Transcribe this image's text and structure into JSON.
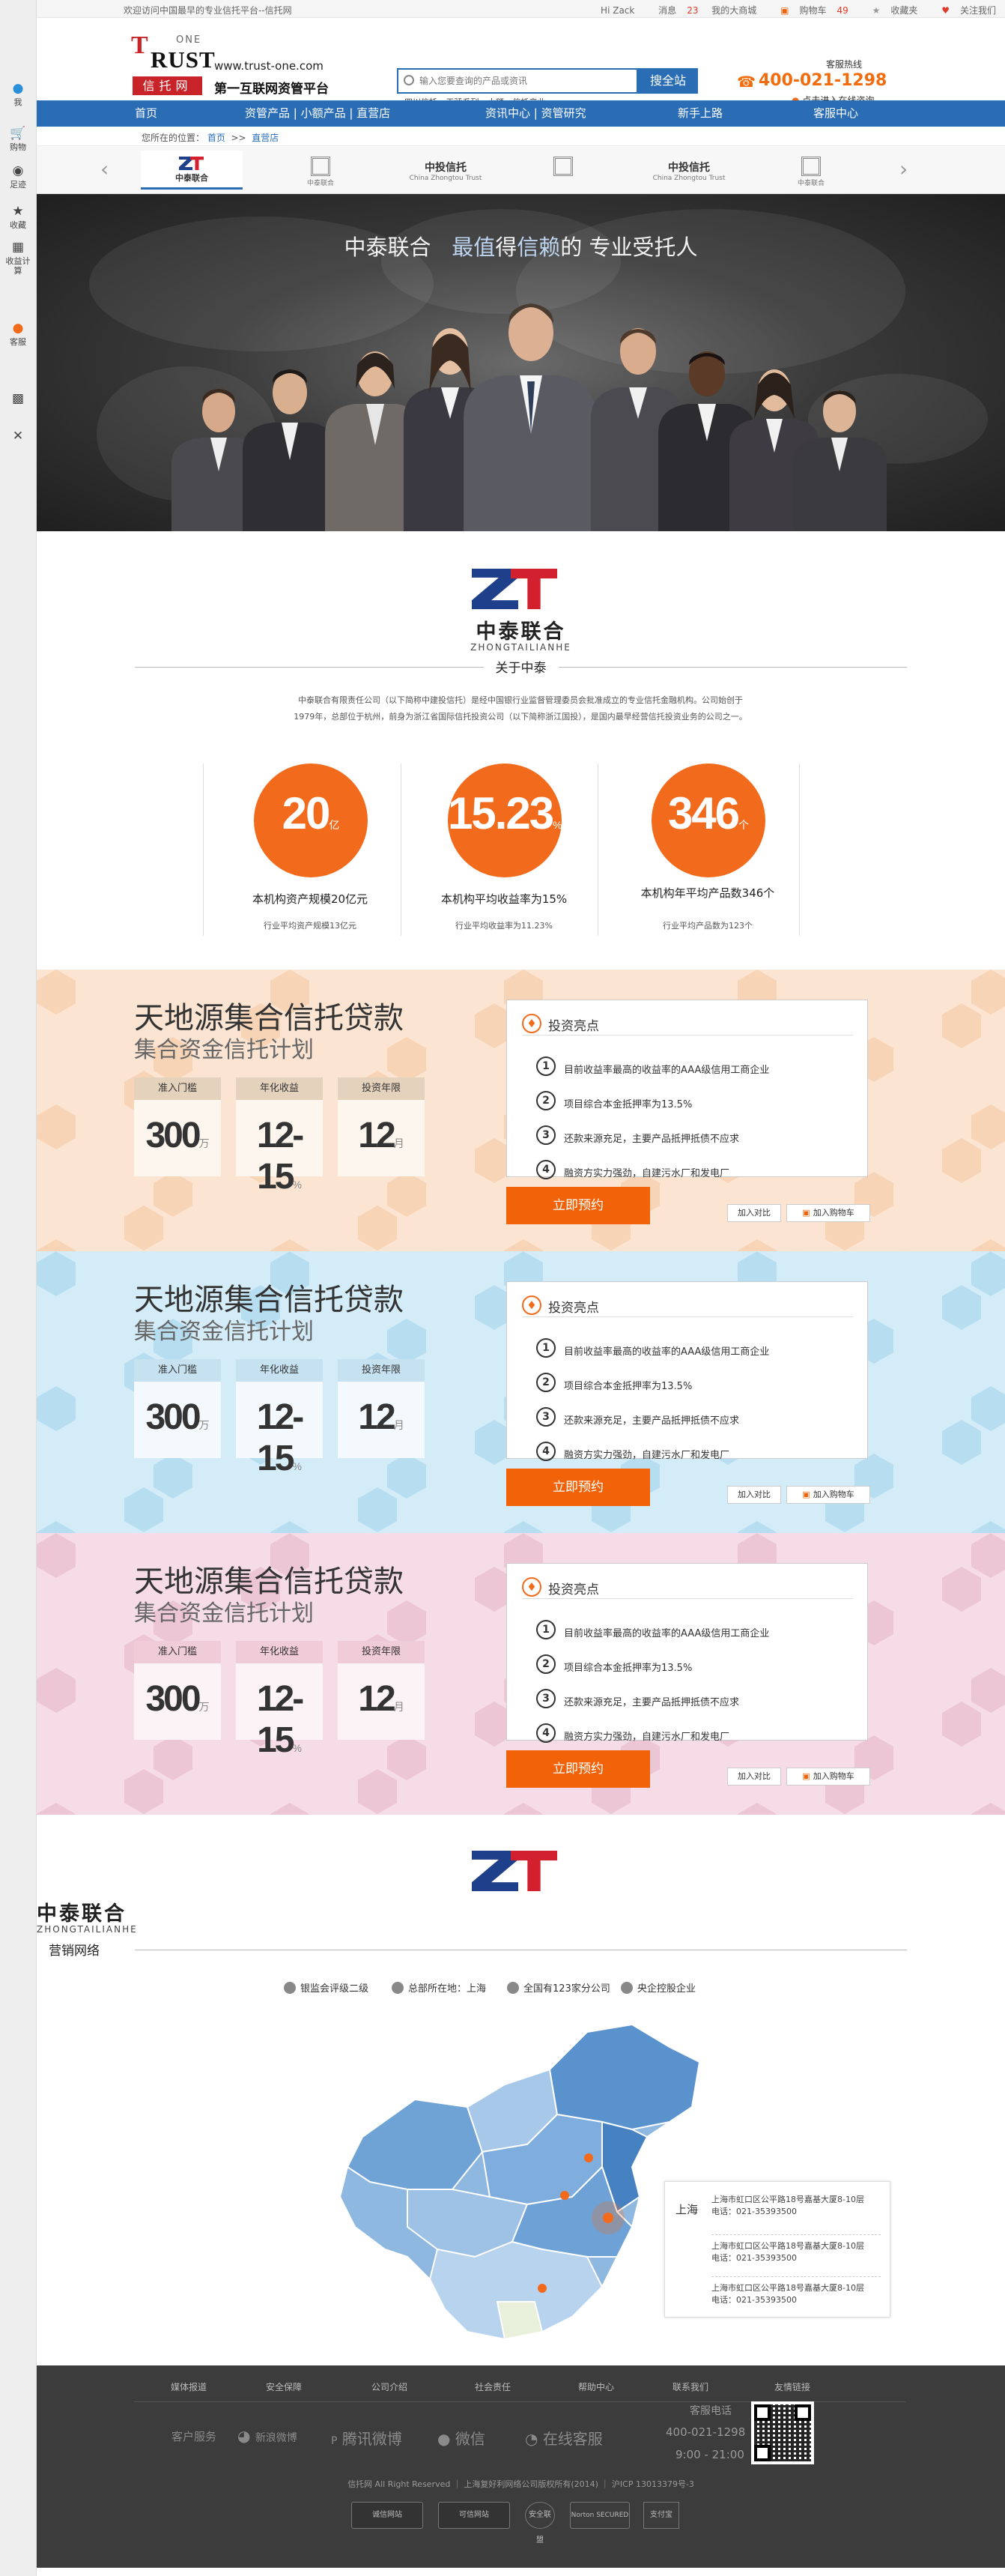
{
  "sidebar": {
    "items": [
      {
        "icon": "user-icon",
        "label": "我"
      },
      {
        "icon": "cart-icon",
        "label": "购物"
      },
      {
        "icon": "eye-icon",
        "label": "足迹"
      },
      {
        "icon": "star-icon",
        "label": "收藏"
      },
      {
        "icon": "calculator-icon",
        "label": "收益计算"
      },
      {
        "icon": "chat-icon",
        "label": "客服"
      },
      {
        "icon": "qrcode-icon",
        "label": ""
      },
      {
        "icon": "close-icon",
        "label": ""
      }
    ]
  },
  "topbar": {
    "welcome": "欢迎访问中国最早的专业信托平台--信托网",
    "greeting": "Hi Zack",
    "messages": "消息",
    "messages_count": "23",
    "my_mall": "我的大商城",
    "cart": "购物车",
    "cart_count": "49",
    "favorites": "收藏夹",
    "follow": "关注我们"
  },
  "header": {
    "logo_trust": "RUST",
    "logo_t": "T",
    "logo_one": "ONE",
    "logo_cn": "信托网",
    "site_url": "www.trust-one.com",
    "slogan": "第一互联网资管平台",
    "search_placeholder": "输入您要查询的产品或资讯",
    "search_button": "搜全站",
    "hot_words": [
      "四川信托",
      "天骄系列",
      "小额",
      "信托产业"
    ],
    "hotline_label": "客服热线",
    "hotline_number": "400-021-1298",
    "online_consult": "点击进入在线咨询"
  },
  "nav": {
    "items": [
      "首页",
      "资管产品 | 小额产品 | 直营店",
      "资讯中心 | 资管研究",
      "新手上路",
      "客服中心"
    ]
  },
  "breadcrumb": {
    "prefix": "您所在的位置",
    "home": "首页",
    "sep": ">>",
    "current": "直营店"
  },
  "brands": {
    "items": [
      {
        "type": "zt",
        "label": "中泰联合"
      },
      {
        "type": "box",
        "label": "中泰联合"
      },
      {
        "type": "text",
        "label": "中投信托",
        "sub": "China Zhongtou Trust"
      },
      {
        "type": "box",
        "label": ""
      },
      {
        "type": "text",
        "label": "中投信托",
        "sub": "China Zhongtou Trust"
      },
      {
        "type": "box",
        "label": "中泰联合"
      }
    ],
    "prev": "‹",
    "next": "›"
  },
  "hero": {
    "title_part1": "中泰联合",
    "title_highlight1": "最值",
    "title_part2": "得",
    "title_highlight2": "信赖",
    "title_part3": "的 专业受托人"
  },
  "about": {
    "company_cn": "中泰联合",
    "company_en": "ZHONGTAILIANHE",
    "section_title": "关于中泰",
    "intro": "中泰联合有限责任公司（以下简称中建投信托）是经中国银行业监督管理委员会批准成立的专业信托金融机构。公司始创于1979年，总部位于杭州，前身为浙江省国际信托投资公司（以下简称浙江国投），是国内最早经营信托投资业务的公司之一。",
    "stats": [
      {
        "value": "20",
        "unit": "亿",
        "label": "本机构资产规模20亿元",
        "sub": "行业平均资产规模13亿元"
      },
      {
        "value": "15.23",
        "unit": "%",
        "label": "本机构平均收益率为15%",
        "sub": "行业平均收益率为11.23%"
      },
      {
        "value": "346",
        "unit": "个",
        "label": "本机构年平均产品数346个",
        "sub": "行业平均产品数为123个"
      }
    ]
  },
  "products": [
    {
      "theme": "orange",
      "title": "天地源集合信托贷款",
      "subtitle": "集合资金信托计划",
      "cards": [
        {
          "label": "准入门槛",
          "value": "300",
          "unit": "万"
        },
        {
          "label": "年化收益",
          "value": "12-15",
          "unit": "%"
        },
        {
          "label": "投资年限",
          "value": "12",
          "unit": "月"
        }
      ],
      "highlights_title": "投资亮点",
      "highlights": [
        "目前收益率最高的收益率的AAA级信用工商企业",
        "项目综合本金抵押率为13.5%",
        "还款来源充足，主要产品抵押抵债不应求",
        "融资方实力强劲，自建污水厂和发电厂"
      ],
      "reserve": "立即预约",
      "compare": "加入对比",
      "cart": "加入购物车"
    },
    {
      "theme": "blue",
      "title": "天地源集合信托贷款",
      "subtitle": "集合资金信托计划",
      "cards": [
        {
          "label": "准入门槛",
          "value": "300",
          "unit": "万"
        },
        {
          "label": "年化收益",
          "value": "12-15",
          "unit": "%"
        },
        {
          "label": "投资年限",
          "value": "12",
          "unit": "月"
        }
      ],
      "highlights_title": "投资亮点",
      "highlights": [
        "目前收益率最高的收益率的AAA级信用工商企业",
        "项目综合本金抵押率为13.5%",
        "还款来源充足，主要产品抵押抵债不应求",
        "融资方实力强劲，自建污水厂和发电厂"
      ],
      "reserve": "立即预约",
      "compare": "加入对比",
      "cart": "加入购物车"
    },
    {
      "theme": "pink",
      "title": "天地源集合信托贷款",
      "subtitle": "集合资金信托计划",
      "cards": [
        {
          "label": "准入门槛",
          "value": "300",
          "unit": "万"
        },
        {
          "label": "年化收益",
          "value": "12-15",
          "unit": "%"
        },
        {
          "label": "投资年限",
          "value": "12",
          "unit": "月"
        }
      ],
      "highlights_title": "投资亮点",
      "highlights": [
        "目前收益率最高的收益率的AAA级信用工商企业",
        "项目综合本金抵押率为13.5%",
        "还款来源充足，主要产品抵押抵债不应求",
        "融资方实力强劲，自建污水厂和发电厂"
      ],
      "reserve": "立即预约",
      "compare": "加入对比",
      "cart": "加入购物车"
    }
  ],
  "network": {
    "company_cn": "中泰联合",
    "company_en": "ZHONGTAILIANHE",
    "section_title": "营销网络",
    "stats": [
      "银监会评级二级",
      "总部所在地：上海",
      "全国有123家分公司",
      "央企控股企业"
    ],
    "office_city": "上海",
    "offices": [
      {
        "address": "上海市虹口区公平路18号嘉基大厦8-10层",
        "phone": "电话：021-35393500"
      },
      {
        "address": "上海市虹口区公平路18号嘉基大厦8-10层",
        "phone": "电话：021-35393500"
      },
      {
        "address": "上海市虹口区公平路18号嘉基大厦8-10层",
        "phone": "电话：021-35393500"
      }
    ]
  },
  "footer": {
    "links": [
      "媒体报道",
      "安全保障",
      "公司介绍",
      "社会责任",
      "帮助中心",
      "联系我们",
      "友情链接"
    ],
    "service": "客户服务",
    "weibo": "新浪微博",
    "qq_weibo": "腾讯微博",
    "weixin": "微信",
    "online": "在线客服",
    "hotline_label": "客服电话",
    "hotline": "400-021-1298",
    "hours": "9:00 - 21:00",
    "copyright": "信托网 All Right Reserved ｜ 上海复好利网络公司版权所有(2014) ｜ 沪ICP 13013379号-3",
    "badges": [
      "诚信网站",
      "可信网站",
      "安全联盟",
      "Norton SECURED",
      "支付宝"
    ]
  }
}
